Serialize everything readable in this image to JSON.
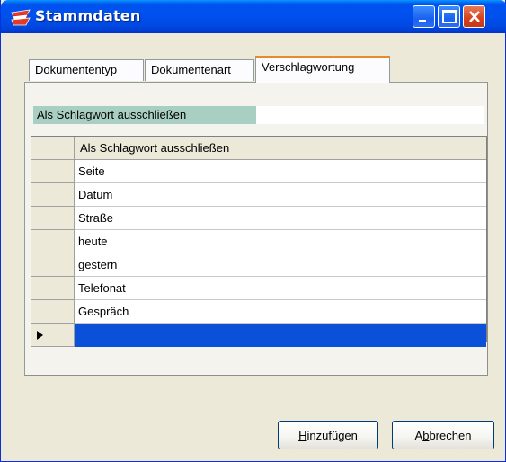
{
  "window": {
    "title": "Stammdaten"
  },
  "tabs": [
    {
      "label": "Dokumententyp",
      "active": false
    },
    {
      "label": "Dokumentenart",
      "active": false
    },
    {
      "label": "Verschlagwortung",
      "active": true
    }
  ],
  "filter": {
    "label": "Als Schlagwort ausschließen",
    "value": ""
  },
  "grid": {
    "column_header": "Als Schlagwort ausschließen",
    "rows": [
      "Seite",
      "Datum",
      "Straße",
      "heute",
      "gestern",
      "Telefonat",
      "Gespräch",
      ""
    ],
    "current_row_index": 7,
    "selection_color": "#0a50d8"
  },
  "buttons": {
    "add": {
      "pre": "",
      "mnemonic": "H",
      "post": "inzufügen"
    },
    "cancel": {
      "pre": "A",
      "mnemonic": "b",
      "post": "brechen"
    }
  },
  "colors": {
    "titlebar": "#0050ee",
    "active_tab_accent": "#e68b2c",
    "filter_label_bg": "#a9cfc2",
    "close_button": "#d5411b"
  },
  "icons": {
    "app": "stack-of-papers-icon",
    "minimize": "minimize-icon",
    "maximize": "maximize-icon",
    "close": "close-icon",
    "row_pointer": "row-pointer-triangle-icon"
  }
}
